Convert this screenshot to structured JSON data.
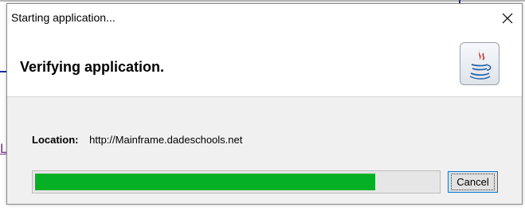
{
  "dialog": {
    "title": "Starting application...",
    "heading": "Verifying application.",
    "location_label": "Location:",
    "location_value": "http://Mainframe.dadeschools.net",
    "cancel_label": "Cancel",
    "progress_fraction": 0.845,
    "progress_color": "#06b025",
    "close_icon": "close-icon",
    "logo_icon": "java-logo-icon"
  },
  "background": {
    "link_fragment": "L"
  }
}
